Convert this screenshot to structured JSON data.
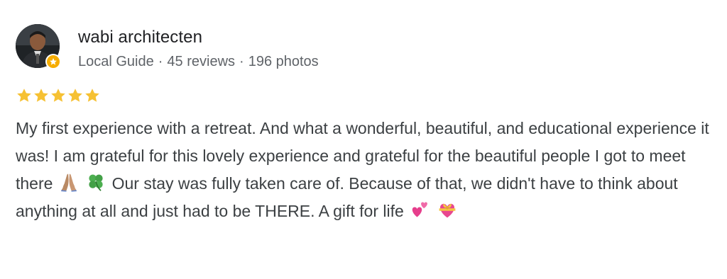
{
  "review": {
    "author": {
      "name": "wabi architecten",
      "badge": "Local Guide",
      "reviews": "45 reviews",
      "photos": "196 photos",
      "separator": "·"
    },
    "rating": 5,
    "rating_max": 5,
    "star_color": "#f6c133",
    "text": {
      "part1": "My first experience with a retreat. And what a wonderful, beautiful, and educational experience it was! I am grateful for this lovely experience and grateful for the beautiful people I got to meet there",
      "part2": "Our stay was fully taken care of. Because of that, we didn't have to think about anything at all and just had to be THERE. A gift for life",
      "emoji_after_part1": [
        "folded-hands-icon",
        "four-leaf-clover-icon"
      ],
      "emoji_after_part2": [
        "two-hearts-icon",
        "heart-with-ribbon-icon"
      ]
    }
  }
}
